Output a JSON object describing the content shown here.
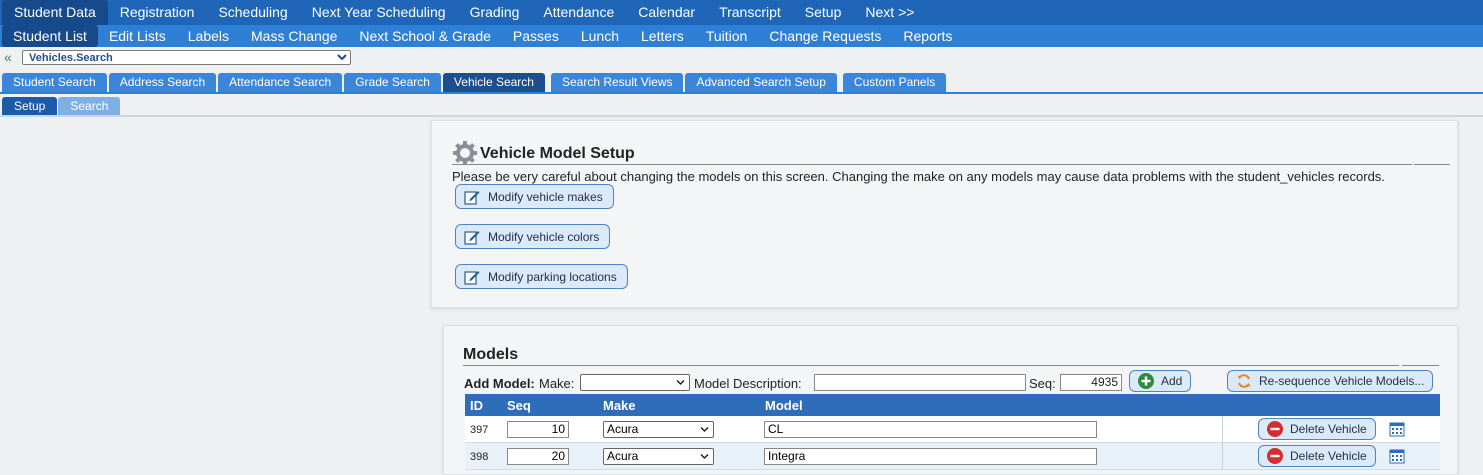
{
  "top_nav": [
    "Student Data",
    "Registration",
    "Scheduling",
    "Next Year Scheduling",
    "Grading",
    "Attendance",
    "Calendar",
    "Transcript",
    "Setup",
    "Next >>"
  ],
  "sub_nav": [
    "Student List",
    "Edit Lists",
    "Labels",
    "Mass Change",
    "Next School & Grade",
    "Passes",
    "Lunch",
    "Letters",
    "Tuition",
    "Change Requests",
    "Reports"
  ],
  "path_select": "Vehicles.Search",
  "search_tabs": [
    "Student Search",
    "Address Search",
    "Attendance Search",
    "Grade Search",
    "Vehicle Search",
    "Search Result Views",
    "Advanced Search Setup",
    "Custom Panels"
  ],
  "sub_tabs": [
    "Setup",
    "Search"
  ],
  "setup_panel": {
    "title": "Vehicle Model Setup",
    "warning": "Please be very careful about changing the models on this screen. Changing the make on any models may cause data problems with the student_vehicles records.",
    "buttons": [
      "Modify vehicle makes",
      "Modify vehicle colors",
      "Modify parking locations"
    ]
  },
  "models_panel": {
    "title": "Models",
    "add_model_label": "Add Model:",
    "make_label": "Make:",
    "model_description_label": "Model Description:",
    "seq_label": "Seq:",
    "seq_value": "4935",
    "add_button": "Add",
    "resequence_button": "Re-sequence Vehicle Models...",
    "columns": [
      "ID",
      "Seq",
      "Make",
      "Model"
    ],
    "rows": [
      {
        "id": "397",
        "seq": "10",
        "make": "Acura",
        "model": "CL",
        "delete": "Delete Vehicle"
      },
      {
        "id": "398",
        "seq": "20",
        "make": "Acura",
        "model": "Integra",
        "delete": "Delete Vehicle"
      }
    ]
  },
  "colors": {
    "nav_bg": "#1f66b8",
    "subnav_bg": "#2e7fd6",
    "active_tab": "#1d4f8c",
    "table_header": "#2e6db9",
    "delete_icon": "#d32f2f",
    "add_icon": "#2e8b3e"
  }
}
